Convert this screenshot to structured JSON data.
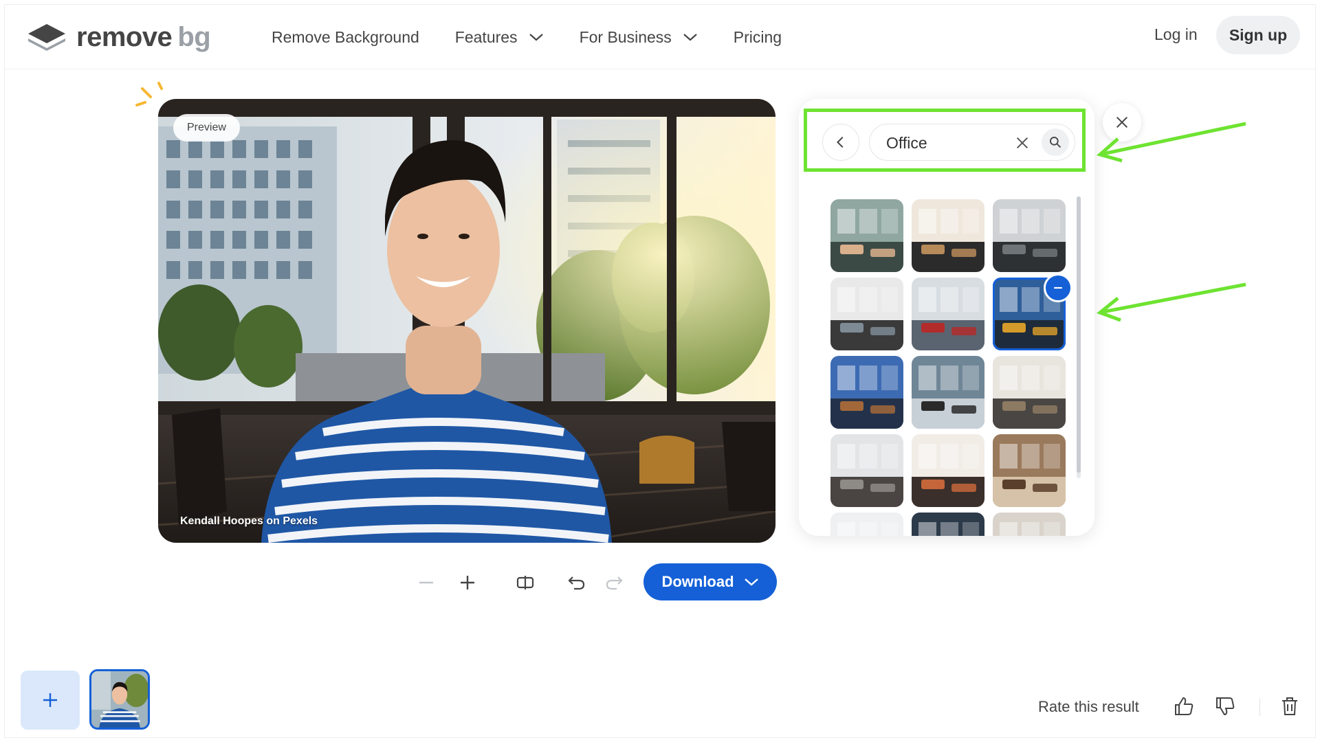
{
  "header": {
    "logo": {
      "word1": "remove",
      "word2": "bg"
    },
    "nav": [
      {
        "label": "Remove Background",
        "has_chevron": false
      },
      {
        "label": "Features",
        "has_chevron": true
      },
      {
        "label": "For Business",
        "has_chevron": true
      },
      {
        "label": "Pricing",
        "has_chevron": false
      }
    ],
    "login_label": "Log in",
    "signup_label": "Sign up"
  },
  "preview": {
    "badge": "Preview",
    "credit": "Kendall Hoopes on Pexels"
  },
  "toolbar": {
    "icons": [
      "zoom-out-icon",
      "zoom-in-icon",
      "compare-icon",
      "undo-icon",
      "redo-icon"
    ],
    "download_label": "Download"
  },
  "panel": {
    "search": {
      "value": "Office",
      "placeholder": ""
    },
    "thumbnails": [
      {
        "scene": "cafe",
        "selected": false
      },
      {
        "scene": "desk",
        "selected": false
      },
      {
        "scene": "open-office",
        "selected": false
      },
      {
        "scene": "workstation",
        "selected": false
      },
      {
        "scene": "corridor",
        "selected": false
      },
      {
        "scene": "lounge-chairs",
        "selected": true
      },
      {
        "scene": "blue-room",
        "selected": false
      },
      {
        "scene": "window-view",
        "selected": false
      },
      {
        "scene": "bright-desk",
        "selected": false
      },
      {
        "scene": "lobby",
        "selected": false
      },
      {
        "scene": "meeting-room",
        "selected": false
      },
      {
        "scene": "library",
        "selected": false
      },
      {
        "scene": "partial-1",
        "selected": false
      },
      {
        "scene": "partial-2",
        "selected": false
      },
      {
        "scene": "partial-3",
        "selected": false
      }
    ]
  },
  "bottom": {
    "rate_label": "Rate this result"
  },
  "colors": {
    "accent": "#1560d7",
    "highlight": "#6ee331",
    "text": "#454545"
  }
}
